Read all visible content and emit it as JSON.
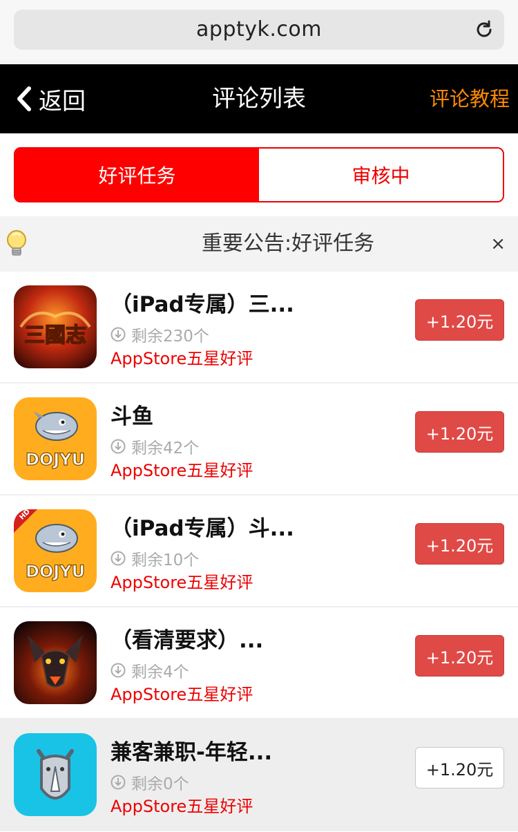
{
  "browser": {
    "url": "apptyk.com",
    "reload_icon": "reload-icon"
  },
  "navbar": {
    "back_label": "返回",
    "title": "评论列表",
    "right_link": "评论教程"
  },
  "tabs": [
    {
      "label": "好评任务",
      "active": true
    },
    {
      "label": "审核中",
      "active": false
    }
  ],
  "notice": {
    "text": "重要公告:好评任务",
    "close": "×",
    "icon": "lightbulb-icon"
  },
  "tasks": [
    {
      "name": "（iPad专属）三...",
      "remaining": "剩余230个",
      "type": "AppStore五星好评",
      "price": "+1.20元",
      "icon": "sanguozhi-app-icon"
    },
    {
      "name": "斗鱼",
      "remaining": "剩余42个",
      "type": "AppStore五星好评",
      "price": "+1.20元",
      "icon": "douyu-app-icon"
    },
    {
      "name": "（iPad专属）斗...",
      "remaining": "剩余10个",
      "type": "AppStore五星好评",
      "price": "+1.20元",
      "icon": "douyu-hd-app-icon"
    },
    {
      "name": "（看清要求）...",
      "remaining": "剩余4个",
      "type": "AppStore五星好评",
      "price": "+1.20元",
      "icon": "dragon-game-app-icon"
    },
    {
      "name": "兼客兼职-年轻...",
      "remaining": "剩余0个",
      "type": "AppStore五星好评",
      "price": "+1.20元",
      "icon": "rhino-app-icon"
    }
  ],
  "colors": {
    "accent_red": "#ff0000",
    "nav_orange": "#ff8a00",
    "button_red": "#e04a46"
  }
}
